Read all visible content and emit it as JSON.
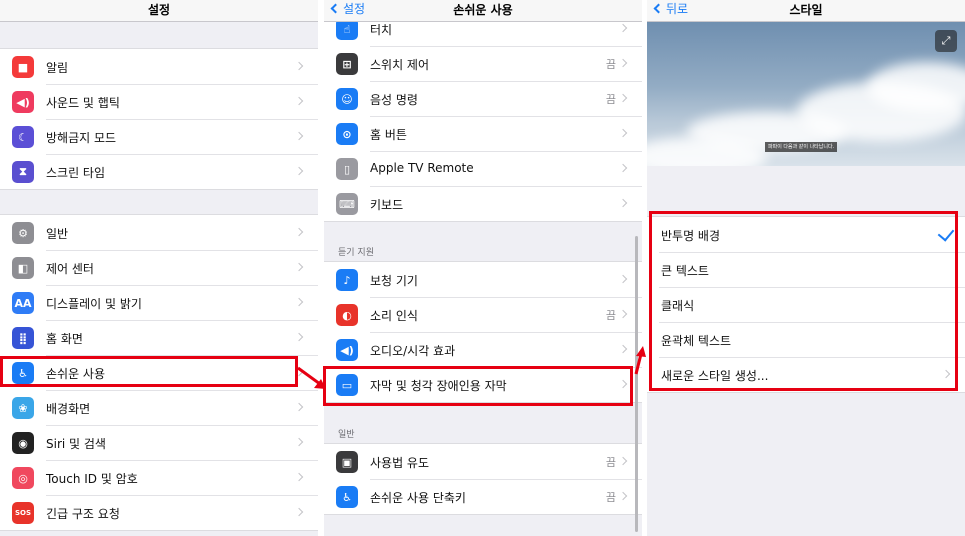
{
  "colors": {
    "highlight": "#e60012",
    "ios_blue": "#1a7cf5",
    "value_gray": "#8e8e93"
  },
  "panel1": {
    "title": "설정",
    "group1": [
      {
        "label": "알림",
        "icon": "notifications-icon",
        "color": "#f43a3a",
        "glyph": "■"
      },
      {
        "label": "사운드 및 햅틱",
        "icon": "sounds-icon",
        "color": "#ef3b5f",
        "glyph": "◀)"
      },
      {
        "label": "방해금지 모드",
        "icon": "moon-icon",
        "color": "#5b4fd6",
        "glyph": "☾"
      },
      {
        "label": "스크린 타임",
        "icon": "hourglass-icon",
        "color": "#5a4fd0",
        "glyph": "⧗"
      }
    ],
    "group2": [
      {
        "label": "일반",
        "icon": "gear-icon",
        "color": "#8e8e93",
        "glyph": "⚙"
      },
      {
        "label": "제어 센터",
        "icon": "control-center-icon",
        "color": "#8e8e93",
        "glyph": "◧"
      },
      {
        "label": "디스플레이 및 밝기",
        "icon": "display-icon",
        "color": "#2f7cf6",
        "glyph": "AA"
      },
      {
        "label": "홈 화면",
        "icon": "home-screen-icon",
        "color": "#3654d6",
        "glyph": "⣿"
      },
      {
        "label": "손쉬운 사용",
        "icon": "accessibility-icon",
        "color": "#1a7cf5",
        "glyph": "♿"
      },
      {
        "label": "배경화면",
        "icon": "wallpaper-icon",
        "color": "#3aa6e8",
        "glyph": "❀"
      },
      {
        "label": "Siri 및 검색",
        "icon": "siri-icon",
        "color": "#222222",
        "glyph": "◉"
      },
      {
        "label": "Touch ID 및 암호",
        "icon": "fingerprint-icon",
        "color": "#f0485e",
        "glyph": "◎"
      },
      {
        "label": "긴급 구조 요청",
        "icon": "sos-icon",
        "color": "#e8332a",
        "glyph": "SOS"
      }
    ]
  },
  "panel2": {
    "back": "설정",
    "title": "손쉬운 사용",
    "group1": [
      {
        "label": "터치",
        "icon": "touch-icon",
        "color": "#1a7cf5",
        "glyph": "☝",
        "value": ""
      },
      {
        "label": "스위치 제어",
        "icon": "switch-control-icon",
        "color": "#3a3a3c",
        "glyph": "⊞",
        "value": "끔"
      },
      {
        "label": "음성 명령",
        "icon": "voice-control-icon",
        "color": "#1a7cf5",
        "glyph": "☺",
        "value": "끔"
      },
      {
        "label": "홈 버튼",
        "icon": "home-button-icon",
        "color": "#1a7cf5",
        "glyph": "⊙",
        "value": ""
      },
      {
        "label": "Apple TV Remote",
        "icon": "remote-icon",
        "color": "#9a9aa0",
        "glyph": "▯",
        "value": ""
      },
      {
        "label": "키보드",
        "icon": "keyboard-icon",
        "color": "#9a9aa0",
        "glyph": "⌨",
        "value": ""
      }
    ],
    "section_hearing": "듣기 지원",
    "group2": [
      {
        "label": "보청 기기",
        "icon": "ear-icon",
        "color": "#1a7cf5",
        "glyph": "♪",
        "value": ""
      },
      {
        "label": "소리 인식",
        "icon": "sound-recognition-icon",
        "color": "#e8332a",
        "glyph": "◐",
        "value": "끔"
      },
      {
        "label": "오디오/시각 효과",
        "icon": "audio-visual-icon",
        "color": "#1a7cf5",
        "glyph": "◀)",
        "value": ""
      },
      {
        "label": "자막 및 청각 장애인용 자막",
        "icon": "captions-icon",
        "color": "#1a7cf5",
        "glyph": "▭",
        "value": ""
      }
    ],
    "section_general": "일반",
    "group3": [
      {
        "label": "사용법 유도",
        "icon": "guided-access-icon",
        "color": "#3a3a3c",
        "glyph": "▣",
        "value": "끔"
      },
      {
        "label": "손쉬운 사용 단축키",
        "icon": "accessibility-shortcut-icon",
        "color": "#1a7cf5",
        "glyph": "♿",
        "value": "끔"
      }
    ]
  },
  "panel3": {
    "back": "뒤로",
    "title": "스타일",
    "caption": "파파이 다음과 같이 나타납니다.",
    "expand_icon": "expand-icon",
    "options": [
      {
        "label": "반투명 배경",
        "checked": true,
        "chevron": false
      },
      {
        "label": "큰 텍스트",
        "checked": false,
        "chevron": false
      },
      {
        "label": "클래식",
        "checked": false,
        "chevron": false
      },
      {
        "label": "윤곽체 텍스트",
        "checked": false,
        "chevron": false
      },
      {
        "label": "새로운 스타일 생성...",
        "checked": false,
        "chevron": true
      }
    ]
  }
}
